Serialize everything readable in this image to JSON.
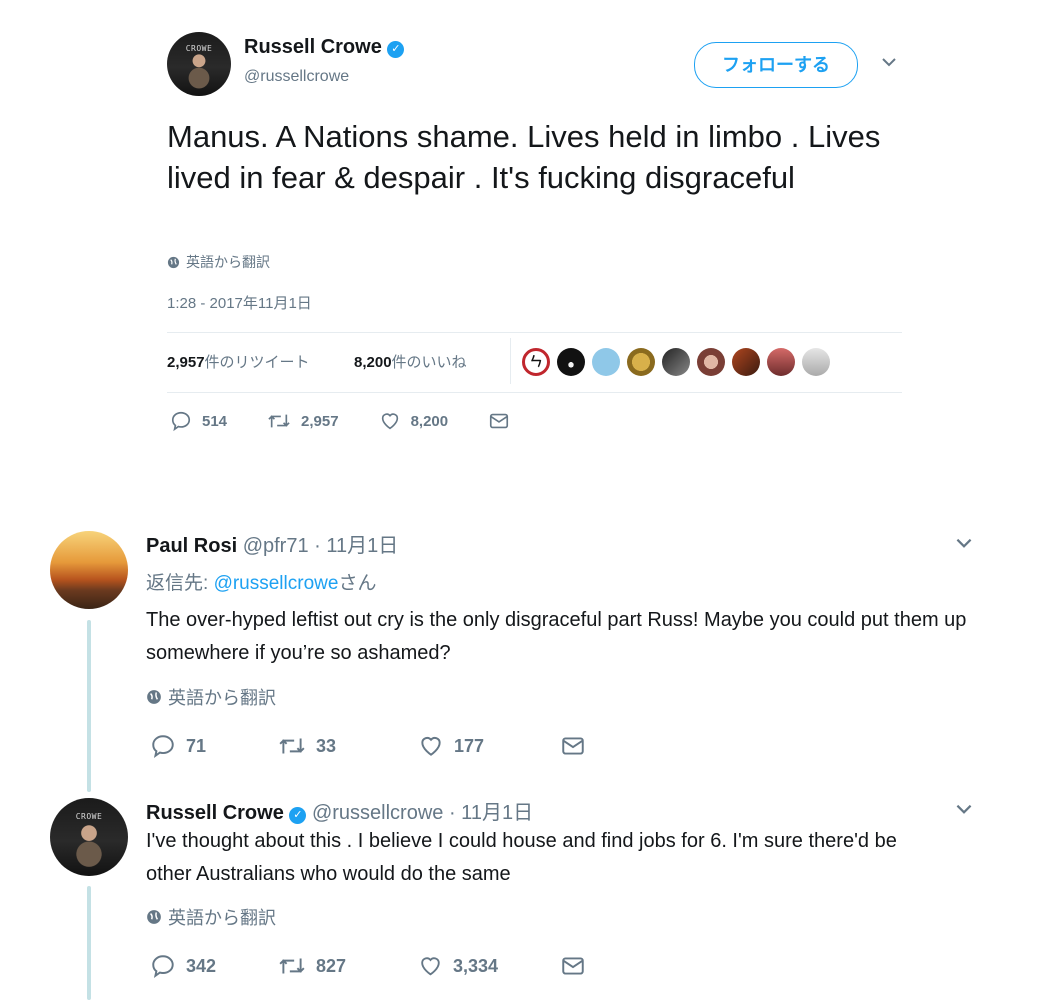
{
  "main_tweet": {
    "name": "Russell Crowe",
    "handle": "@russellcrowe",
    "avatar_text": "CROWE",
    "follow_label": "フォローする",
    "text": "Manus. A Nations shame. Lives held in limbo . Lives lived in fear & despair . It's fucking disgraceful",
    "translate": "英語から翻訳",
    "timestamp": "1:28 - 2017年11月1日",
    "retweets_count": "2,957",
    "retweets_label": "件のリツイート",
    "likes_count": "8,200",
    "likes_label": "件のいいね",
    "actions": {
      "replies": "514",
      "retweets": "2,957",
      "likes": "8,200"
    }
  },
  "reply1": {
    "name": "Paul Rosi",
    "handle": "@pfr71",
    "date": "· 11月1日",
    "reply_to_prefix": "返信先: ",
    "reply_to_handle": "@russellcrowe",
    "reply_to_suffix": "さん",
    "text": "The over-hyped leftist out cry is the only disgraceful part Russ! Maybe you could put them up somewhere if you’re so ashamed?",
    "translate": "英語から翻訳",
    "actions": {
      "replies": "71",
      "retweets": "33",
      "likes": "177"
    }
  },
  "reply2": {
    "name": "Russell Crowe",
    "handle": "@russellcrowe",
    "date": "· 11月1日",
    "text": "I've thought about this . I believe I could house and find jobs for 6. I'm sure there'd be other Australians who would do the same",
    "translate": "英語から翻訳",
    "actions": {
      "replies": "342",
      "retweets": "827",
      "likes": "3,334"
    }
  },
  "colors": {
    "link": "#1da1f2",
    "muted": "#657786",
    "thread_line": "#c4e1e5"
  },
  "icons": {
    "verified": "✓",
    "chevron": "chevron-down-icon",
    "globe": "globe-icon"
  }
}
